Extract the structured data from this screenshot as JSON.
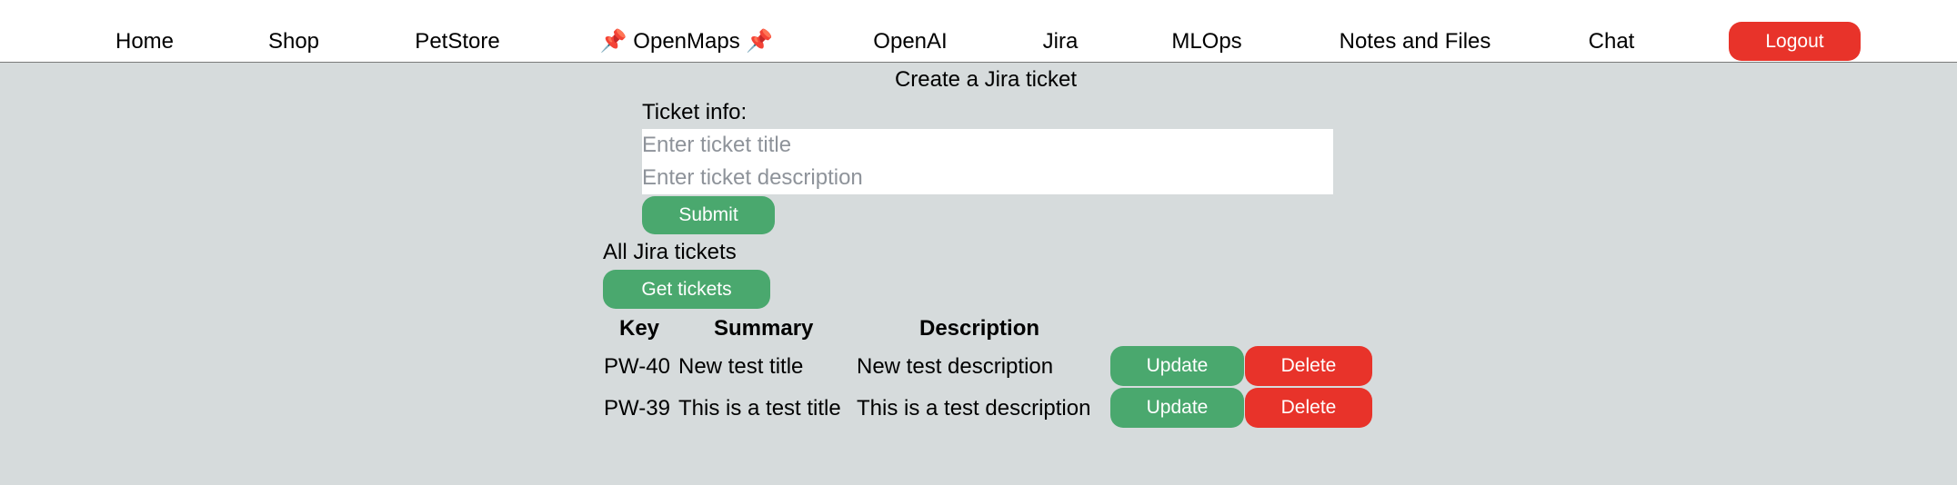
{
  "nav": {
    "items": [
      {
        "label": "Home"
      },
      {
        "label": "Shop"
      },
      {
        "label": "PetStore"
      },
      {
        "label": "OpenMaps",
        "icon": "pushpin-icon"
      },
      {
        "label": "OpenAI"
      },
      {
        "label": "Jira"
      },
      {
        "label": "MLOps"
      },
      {
        "label": "Notes and Files"
      },
      {
        "label": "Chat"
      }
    ],
    "pin_glyph": "📌",
    "logout_label": "Logout"
  },
  "create": {
    "title": "Create a Jira ticket",
    "info_label": "Ticket info:",
    "title_placeholder": "Enter ticket title",
    "description_placeholder": "Enter ticket description",
    "submit_label": "Submit"
  },
  "tickets": {
    "heading": "All Jira tickets",
    "get_button_label": "Get tickets",
    "columns": [
      "Key",
      "Summary",
      "Description"
    ],
    "rows": [
      {
        "key": "PW-40",
        "summary": "New test title",
        "description": "New test description",
        "update_label": "Update",
        "delete_label": "Delete"
      },
      {
        "key": "PW-39",
        "summary": "This is a test title",
        "description": "This is a test description",
        "update_label": "Update",
        "delete_label": "Delete"
      }
    ]
  },
  "colors": {
    "background": "#d6dbdc",
    "primary_green": "#4aa86e",
    "danger_red": "#e8332a",
    "navbar": "#ffffff"
  }
}
